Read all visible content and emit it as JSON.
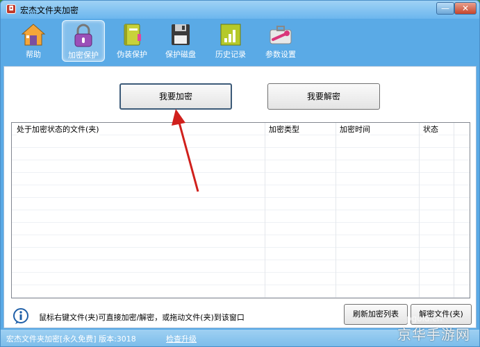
{
  "window": {
    "title": "宏杰文件夹加密",
    "minimize_label": "—",
    "close_label": "✕"
  },
  "toolbar": {
    "items": [
      {
        "label": "帮助",
        "icon": "house-icon"
      },
      {
        "label": "加密保护",
        "icon": "lock-icon",
        "active": true
      },
      {
        "label": "伪装保护",
        "icon": "notebook-icon"
      },
      {
        "label": "保护磁盘",
        "icon": "floppy-disk-icon"
      },
      {
        "label": "历史记录",
        "icon": "chart-icon"
      },
      {
        "label": "参数设置",
        "icon": "wrench-toolbox-icon"
      }
    ]
  },
  "main": {
    "encrypt_button": "我要加密",
    "decrypt_button": "我要解密",
    "list": {
      "columns": [
        "处于加密状态的文件(夹)",
        "加密类型",
        "加密时间",
        "状态"
      ],
      "rows": []
    },
    "hint": "鼠标右键文件(夹)可直接加密/解密，或拖动文件(夹)到该窗口",
    "refresh_button": "刷新加密列表",
    "decrypt_file_button": "解密文件(夹)"
  },
  "statusbar": {
    "text": "宏杰文件夹加密[永久免费]  版本:3018",
    "update_link": "检查升级"
  },
  "watermark": {
    "text": "京华手游网",
    "small": "pgold.cn"
  },
  "colors": {
    "window_blue": "#5aaae6",
    "arrow_red": "#d0201c"
  }
}
